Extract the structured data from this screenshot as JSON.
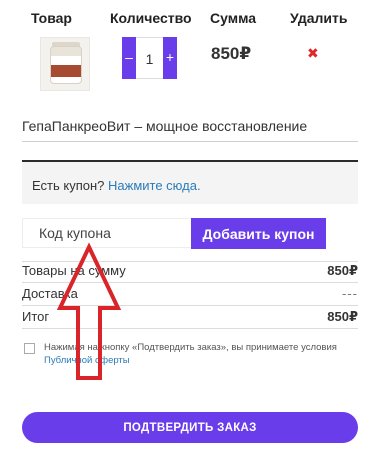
{
  "cart": {
    "headers": {
      "product": "Товар",
      "quantity": "Количество",
      "sum": "Сумма",
      "delete": "Удалить"
    },
    "item": {
      "name": "ГепаПанкреоВит – мощное восстановление",
      "quantity": "1",
      "minus": "–",
      "plus": "+",
      "price": "850₽",
      "delete_icon": "✖"
    }
  },
  "coupon": {
    "question": "Есть купон?",
    "link": "Нажмите сюда.",
    "placeholder": "Код купона",
    "apply_label": "Добавить купон"
  },
  "totals": {
    "subtotal_label": "Товары на сумму",
    "subtotal_value": "850₽",
    "shipping_label": "Доставка",
    "shipping_value": "---",
    "total_label": "Итог",
    "total_value": "850₽"
  },
  "agreement": {
    "text": "Нажимая на кнопку «Подтвердить заказ», вы принимаете условия",
    "link": "Публичной оферты"
  },
  "confirm_label": "ПОДТВЕРДИТЬ ЗАКАЗ",
  "colors": {
    "accent": "#6a3dea",
    "link": "#2a7bb9",
    "delete": "#e0262b",
    "annotation_arrow": "#d9242a"
  }
}
